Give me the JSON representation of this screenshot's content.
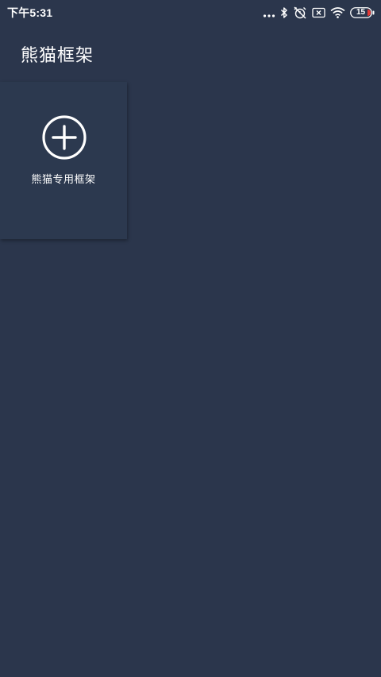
{
  "status_bar": {
    "time": "下午5:31",
    "icons": [
      "more-dots-icon",
      "bluetooth-icon",
      "alarm-off-icon",
      "sim-x-icon",
      "wifi-icon",
      "battery-icon"
    ],
    "battery_level": "15"
  },
  "header": {
    "title": "熊猫框架"
  },
  "tiles": [
    {
      "icon": "add-circle-icon",
      "label": "熊猫专用框架"
    }
  ],
  "colors": {
    "background": "#2b364c",
    "tile": "#2c394f",
    "text": "#ffffff",
    "battery_low": "#e53935"
  }
}
